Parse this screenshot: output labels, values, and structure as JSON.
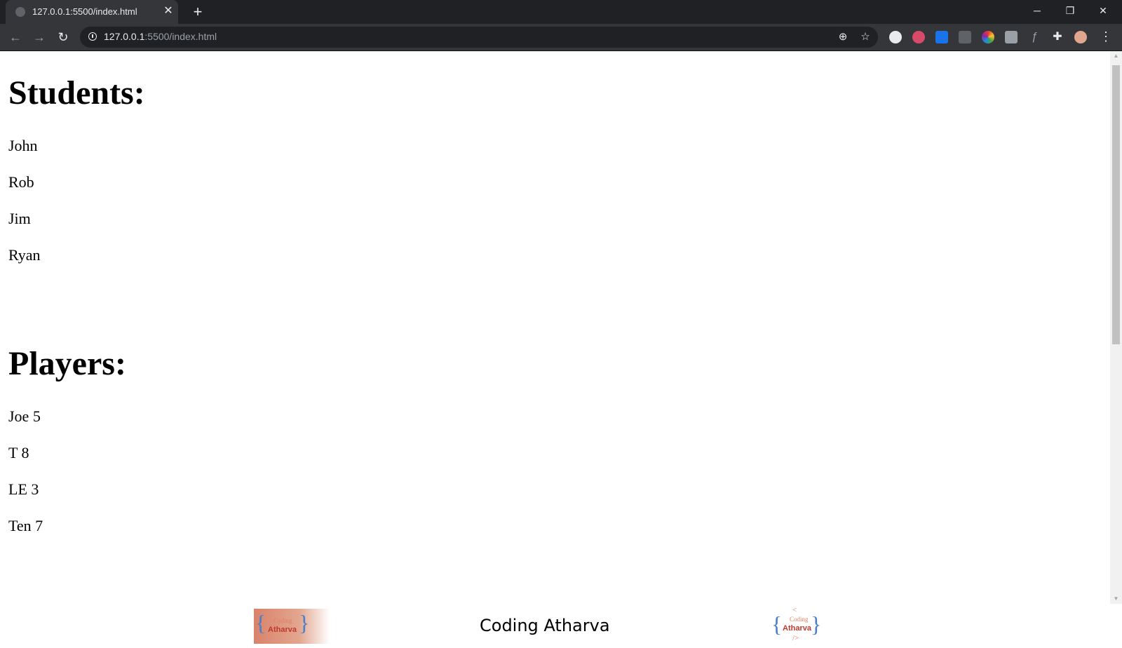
{
  "browser": {
    "tab_title": "127.0.0.1:5500/index.html",
    "url_host": "127.0.0.1",
    "url_rest": ":5500/index.html"
  },
  "page": {
    "sections": [
      {
        "heading": "Students:",
        "items": [
          "John",
          "Rob",
          "Jim",
          "Ryan"
        ]
      },
      {
        "heading": "Players:",
        "items": [
          "Joe 5",
          "T 8",
          "LE 3",
          "Ten 7"
        ]
      }
    ]
  },
  "footer": {
    "title": "Coding Atharva",
    "logo_left": {
      "line1": "Coding",
      "line2": "Atharva"
    },
    "logo_right": {
      "top": "<",
      "line1": "Coding",
      "line2": "Atharva",
      "bottom": "/>"
    }
  },
  "colors": {
    "titlebar": "#202124",
    "toolbar": "#35363a",
    "logo_brace": "#4a7fc9",
    "logo_text": "#c0392b"
  }
}
